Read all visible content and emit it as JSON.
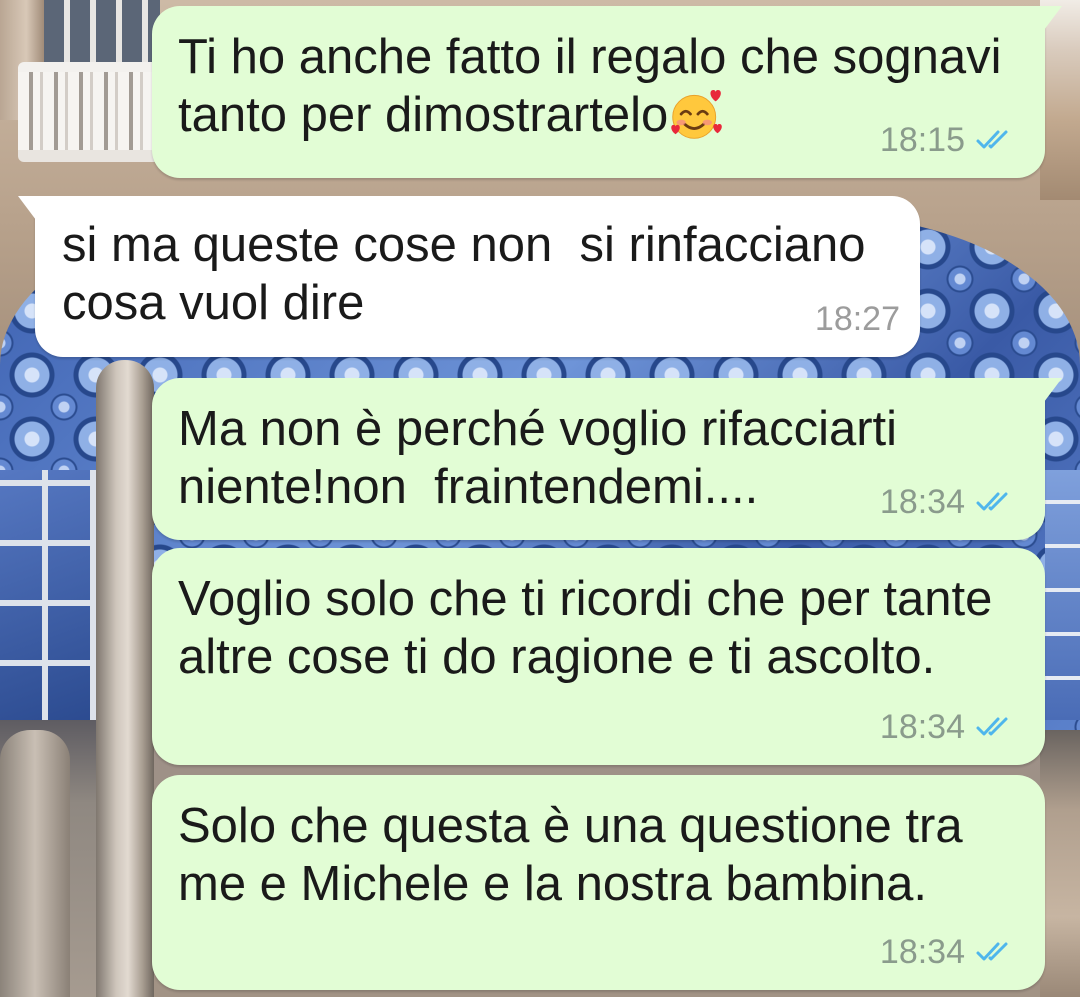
{
  "chat": {
    "messages": [
      {
        "text": "Ti ho anche fatto il regalo che sognavi tanto per dimostrartelo",
        "emoji_icon": "smiling-face-with-hearts-icon",
        "time": "18:15",
        "status_icon": "double-check-read-icon"
      },
      {
        "text": "si ma queste cose non  si rinfacciano cosa vuol dire",
        "time": "18:27"
      },
      {
        "text": "Ma non è perché voglio rifacciarti niente!non  fraintendemi....",
        "time": "18:34",
        "status_icon": "double-check-read-icon"
      },
      {
        "text": "Voglio solo che ti ricordi che per tante altre cose ti do ragione e ti ascolto.",
        "time": "18:34",
        "status_icon": "double-check-read-icon"
      },
      {
        "text": "Solo che questa è una questione tra me e Michele e la nostra bambina.",
        "time": "18:34",
        "status_icon": "double-check-read-icon"
      }
    ]
  },
  "colors": {
    "outgoing_bubble": "#e2fdd5",
    "incoming_bubble": "#ffffff",
    "message_text": "#1a1a1a",
    "time_outgoing": "#8a9b8c",
    "time_incoming": "#9c9c9c",
    "read_check": "#4fb6ec"
  }
}
